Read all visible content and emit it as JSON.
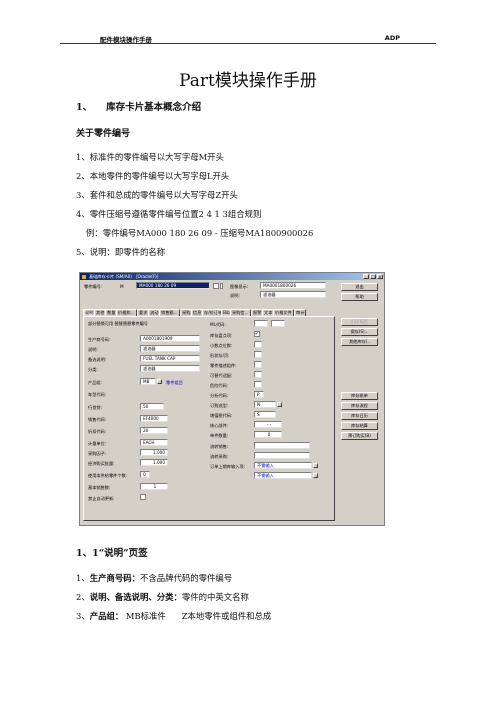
{
  "header": {
    "left": "配件模块操作手册",
    "right": "ADP"
  },
  "title": "Part模块操作手册",
  "section1": {
    "num": "1、",
    "title": "库存卡片基本概念介绍"
  },
  "sub1": "关于零件编号",
  "rules": [
    "1、标准件的零件编号以大写字母M开头",
    "2、本地零件的零件编号以大写字母L开头",
    "3、套件和总成的零件编号以大写字母Z开头",
    "4、零件压缩号遵循零件编号位置2 4 1 3组合规则",
    "例：零件编号MA000 180 26 09  -  压缩号MA1800900026",
    "5、说明：即零件的名称"
  ],
  "window": {
    "title": "基础库存卡片 (SM/A0) ［Oracle(F)］",
    "part_no_label": "零件编号:",
    "part_no_prefix": "M",
    "part_no_value": "MA000 180 26 09",
    "image_label": "图像显示:",
    "image_value": "MA0001800026",
    "desc_label": "说明:",
    "desc_value": "滤油器",
    "buttons": [
      "退出",
      "帮助",
      "打印标签",
      "保存(S)...",
      "其他库存(..",
      "库存账单",
      "库存流程",
      "库存日历",
      "库存结算",
      "预订购买(B)"
    ],
    "tabs": [
      "说明",
      "其他",
      "数量",
      "价格和...",
      "要求",
      "流动",
      "销售额...",
      "采购",
      "信息",
      "存/价订单",
      "Bib",
      "采购信...",
      "报警",
      "文本",
      "价格文件",
      "审计"
    ],
    "left_fields": [
      {
        "label": "部分替换可用 替替替替零件编号",
        "value": ""
      },
      {
        "label": "生产商号码:",
        "value": "A0001801909"
      },
      {
        "label": "说明:",
        "value": "滤油器"
      },
      {
        "label": "备选说明:",
        "value": "FUEL TANK CAP"
      },
      {
        "label": "分类:",
        "value": "滤油器"
      },
      {
        "label": "产品组:",
        "value": "MB",
        "extra": "零件组目"
      },
      {
        "label": "车型代码:",
        "value": ""
      },
      {
        "label": "行贷贷:",
        "value": "50"
      },
      {
        "label": "销售代码:",
        "value": "EF4000"
      },
      {
        "label": "折扣代码:",
        "value": "20"
      },
      {
        "label": "计量单位:",
        "value": "EACH"
      },
      {
        "label": "采购因子:",
        "value": "1.000"
      },
      {
        "label": "经济购买批量:",
        "value": "1.000"
      },
      {
        "label": "使用本供给零件个数:",
        "value": "0"
      },
      {
        "label": "基本销售数:",
        "value": "1"
      },
      {
        "label": "禁止自动更新:",
        "value": ""
      }
    ],
    "right_fields": [
      {
        "label": "ML代码:",
        "value": ""
      },
      {
        "label": "库存盘点项:",
        "value": "✔"
      },
      {
        "label": "小数点位数:",
        "value": ""
      },
      {
        "label": "形状存/页:",
        "value": ""
      },
      {
        "label": "零件描述组件:",
        "value": ""
      },
      {
        "label": "可替代适配:",
        "value": ""
      },
      {
        "label": "危险代码:",
        "value": ""
      },
      {
        "label": "分析代码:",
        "value": "P"
      },
      {
        "label": "订购选型:",
        "value": "N"
      },
      {
        "label": "增值税代码:",
        "value": "S"
      },
      {
        "label": "核心部件:",
        "value": "- -"
      },
      {
        "label": "单件数量:",
        "value": "0"
      },
      {
        "label": "流转销售:",
        "value": ""
      },
      {
        "label": "流转采购:",
        "value": ""
      },
      {
        "label": "订单上期库输入项:",
        "value": "不需输入"
      },
      {
        "label": "",
        "value": "不需输入"
      }
    ]
  },
  "section11": "1、1“说明”页签",
  "items": [
    {
      "num": "1、",
      "key": "生产商号码：",
      "text": "不含品牌代码的零件编号"
    },
    {
      "num": "2、",
      "key": "说明、备选说明、分类：",
      "text": "零件的中英文名称"
    },
    {
      "num": "3、",
      "key": "产品组：",
      "text": " MB标准件      Z本地零件或组件和总成"
    }
  ]
}
